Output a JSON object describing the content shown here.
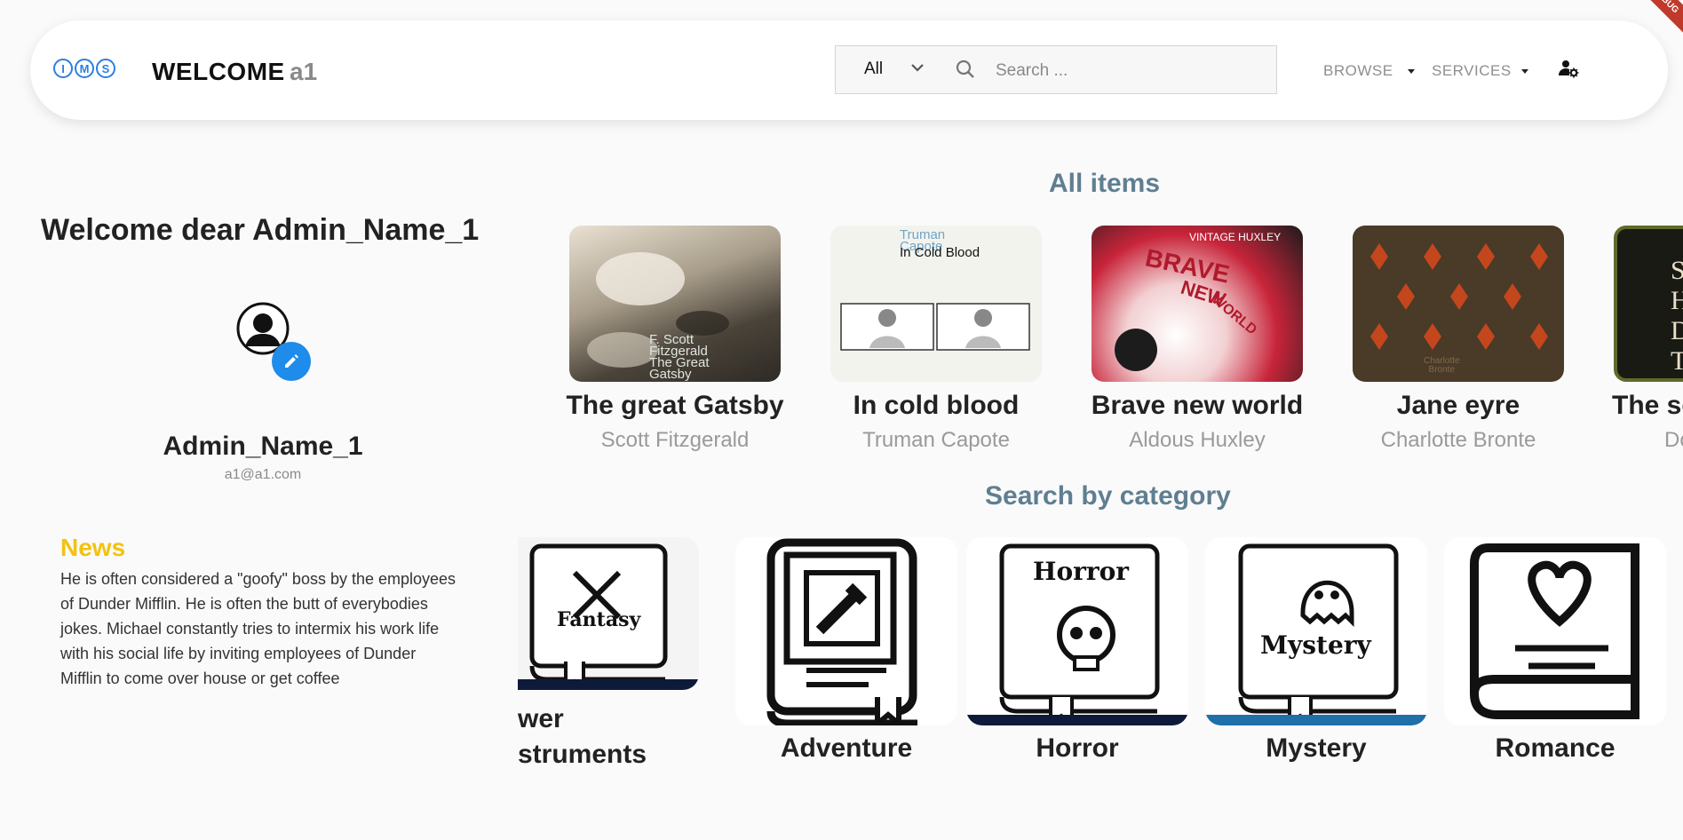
{
  "header": {
    "logo_letters": [
      "I",
      "M",
      "S"
    ],
    "welcome_label": "WELCOME",
    "username": "a1",
    "search": {
      "category_selected": "All",
      "placeholder": "Search ..."
    },
    "nav": {
      "browse": "BROWSE",
      "services": "SERVICES"
    }
  },
  "profile": {
    "greeting": "Welcome dear Admin_Name_1",
    "name": "Admin_Name_1",
    "email": "a1@a1.com"
  },
  "news": {
    "title": "News",
    "body": "He is often considered a \"goofy\" boss by the employees of Dunder Mifflin. He is often the butt of everybodies jokes. Michael constantly tries to intermix his work life with his social life by inviting employees of Dunder Mifflin to come over house or get coffee"
  },
  "all_items": {
    "title": "All items",
    "books": [
      {
        "title": "The great Gatsby",
        "author": "Scott Fitzgerald",
        "cover_text": [
          "F. Scott",
          "Fitzgerald",
          "The Great",
          "Gatsby"
        ]
      },
      {
        "title": "In cold blood",
        "author": "Truman Capote",
        "cover_text": [
          "Truman",
          "Capote",
          "In Cold Blood"
        ]
      },
      {
        "title": "Brave new world",
        "author": "Aldous Huxley",
        "cover_text": [
          "VINTAGE HUXLEY",
          "BRAVE",
          "NEW",
          "WORLD"
        ]
      },
      {
        "title": "Jane eyre",
        "author": "Charlotte Bronte",
        "cover_text": [
          "Charlotte",
          "Bronte"
        ]
      },
      {
        "title": "The se",
        "author": "Do",
        "cover_text": [
          "S",
          "H",
          "D",
          "T"
        ]
      }
    ]
  },
  "categories": {
    "title": "Search by category",
    "items": [
      {
        "label": "wer\nstruments",
        "line1": "wer",
        "line2": "struments",
        "icon_text": "Fantasy"
      },
      {
        "label": "Adventure",
        "icon_text": ""
      },
      {
        "label": "Horror",
        "icon_text": "Horror"
      },
      {
        "label": "Mystery",
        "icon_text": "Mystery"
      },
      {
        "label": "Romance",
        "icon_text": ""
      }
    ]
  }
}
